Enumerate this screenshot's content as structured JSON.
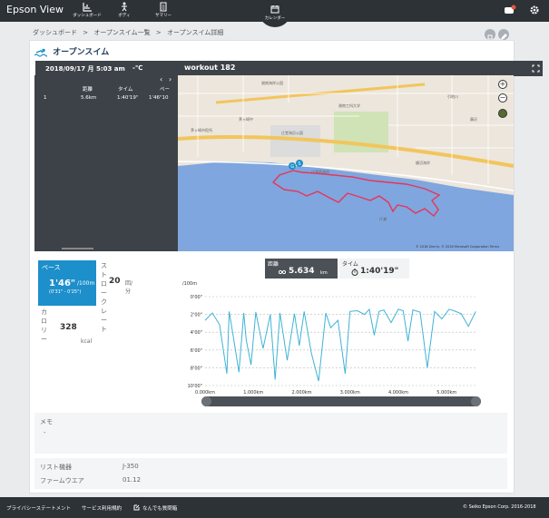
{
  "app": {
    "title": "Epson View"
  },
  "nav": [
    {
      "label": "ダッシュボード",
      "icon": "dashboard-icon"
    },
    {
      "label": "ボディ",
      "icon": "body-icon"
    },
    {
      "label": "サマリー",
      "icon": "summary-icon"
    },
    {
      "label": "カレンダー",
      "icon": "calendar-icon"
    }
  ],
  "breadcrumb": [
    "ダッシュボード",
    ">",
    "オープンスイム一覧",
    ">",
    "オープンスイム詳細"
  ],
  "page": {
    "title": "オープンスイム"
  },
  "workout": {
    "datetime": "2018/09/17 月 5:03 am",
    "temp": "-℃",
    "name": "workout 182"
  },
  "laps": {
    "headers": [
      "",
      "距離",
      "タイム",
      "ペー"
    ],
    "rows": [
      {
        "no": "1",
        "dist": "5.6km",
        "time": "1:40'19\"",
        "pace": "1'46\"10"
      }
    ]
  },
  "map": {
    "attribution": "© 2018 Zenrin, © 2018 Microsoft Corporation Terms",
    "place_labels": [
      "湘南海岸公園",
      "茅ヶ崎中",
      "茅ヶ崎市役所",
      "辻堂海浜公園",
      "辻堂西海岸",
      "湘南工科大学",
      "鵠沼海岸",
      "引地川",
      "藤沢",
      "片瀬"
    ],
    "markers": [
      "G",
      "S"
    ]
  },
  "summary": {
    "pace_label": "ペース",
    "pace_value": "1'46\"",
    "pace_unit": "/100m",
    "pace_range": "(0'31\" - 0'25\")",
    "stroke_label": "ストロークレート",
    "stroke_value": "20",
    "stroke_unit": "回/分",
    "calorie_label": "カロリー",
    "calorie_value": "328",
    "calorie_unit": "kcal"
  },
  "chart_tabs": {
    "distance_label": "距離",
    "distance_value": "5.634",
    "distance_unit": "km",
    "time_label": "タイム",
    "time_value": "1:40'19\""
  },
  "chart_data": {
    "type": "line",
    "ylabel": "/100m",
    "y_ticks": [
      "0'00\"",
      "2'00\"",
      "4'00\"",
      "6'00\"",
      "8'00\"",
      "10'00\""
    ],
    "x_ticks": [
      "0.000km",
      "1.000km",
      "2.000km",
      "3.000km",
      "4.000km",
      "5.000km"
    ],
    "xlim": [
      0,
      5.634
    ],
    "ylim_seconds": [
      0,
      600
    ],
    "series": [
      {
        "x": [
          0.0,
          0.15,
          0.3,
          0.45,
          0.5,
          0.6,
          0.7,
          0.8,
          0.85,
          0.95,
          1.05,
          1.2,
          1.35,
          1.45,
          1.55,
          1.7,
          1.85,
          1.95,
          2.05,
          2.2,
          2.35,
          2.5,
          2.6,
          2.75,
          2.9,
          3.0,
          3.15,
          3.3,
          3.4,
          3.5,
          3.6,
          3.7,
          3.85,
          4.0,
          4.1,
          4.2,
          4.3,
          4.45,
          4.6,
          4.75,
          4.9,
          5.05,
          5.15,
          5.3,
          5.45,
          5.6
        ],
        "y": [
          160,
          110,
          190,
          520,
          100,
          300,
          510,
          110,
          290,
          460,
          105,
          350,
          120,
          560,
          110,
          430,
          115,
          330,
          100,
          380,
          570,
          110,
          210,
          160,
          520,
          100,
          95,
          120,
          85,
          260,
          100,
          90,
          175,
          85,
          95,
          300,
          90,
          105,
          480,
          100,
          150,
          85,
          95,
          115,
          200,
          100
        ]
      }
    ]
  },
  "memo": {
    "label": "メモ",
    "value": "-"
  },
  "meta": [
    {
      "label": "リスト機器",
      "value": "J-350"
    },
    {
      "label": "ファームウエア",
      "value": "01.12"
    }
  ],
  "footer": {
    "privacy": "プライバシーステートメント",
    "terms": "サービス利用規約",
    "contact": "なんでも質問箱",
    "copyright": "© Seiko Epson Corp. 2016-2018"
  },
  "colors": {
    "accent": "#1d8fca",
    "route": "#e8345a",
    "header": "#2d3237",
    "chart_line": "#3fb3d6"
  }
}
